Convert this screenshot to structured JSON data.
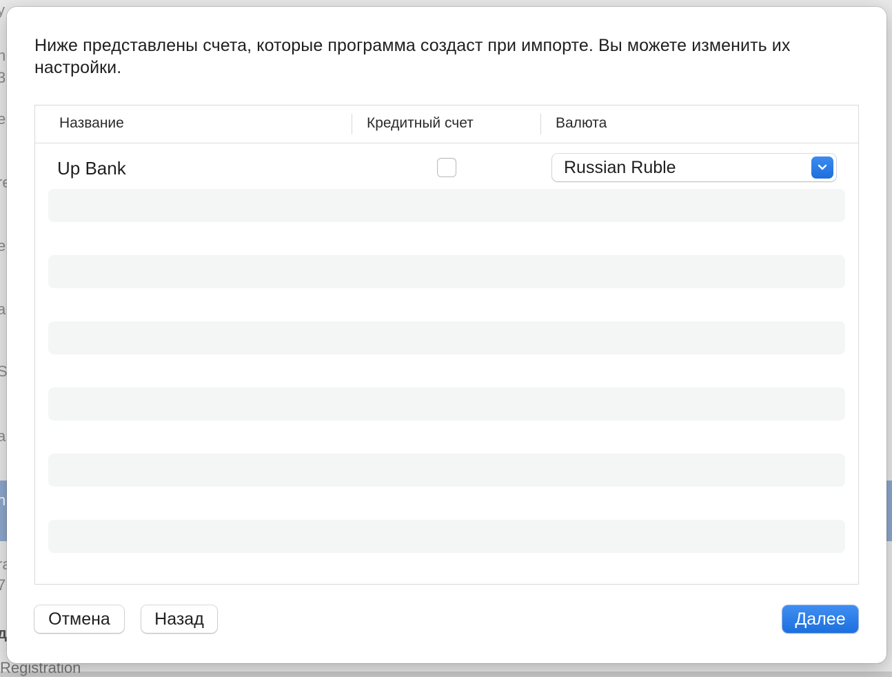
{
  "background_window": {
    "fragments": [
      "y",
      "n",
      "3",
      "e",
      "re",
      "e",
      "a",
      "S",
      "a",
      "n",
      "ra",
      "7",
      "д"
    ],
    "bottom_text": "Registration"
  },
  "dialog": {
    "intro_text": "Ниже представлены счета, которые программа создаст при импорте. Вы можете изменить их настройки.",
    "table": {
      "headers": {
        "name": "Название",
        "credit": "Кредитный счет",
        "currency": "Валюта"
      },
      "rows": [
        {
          "name": "Up Bank",
          "credit_account": false,
          "currency": "Russian Ruble"
        }
      ]
    },
    "buttons": {
      "cancel": "Отмена",
      "back": "Назад",
      "next": "Далее"
    }
  },
  "colors": {
    "accent": "#1d6fdc",
    "stripe": "#f4f5f5"
  }
}
